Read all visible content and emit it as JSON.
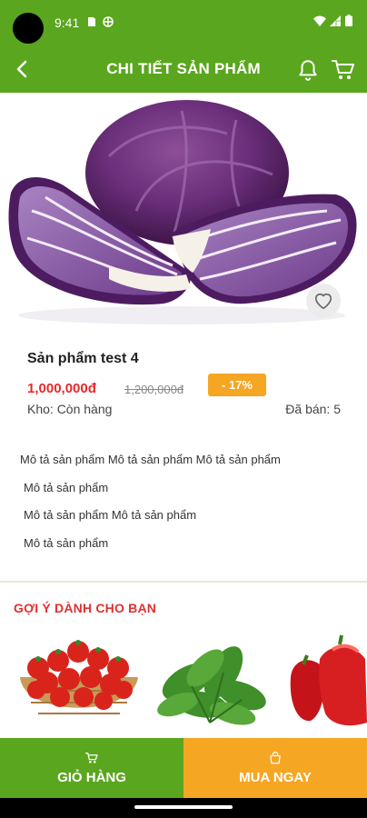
{
  "status": {
    "time": "9:41"
  },
  "header": {
    "title": "CHI TIẾT SẢN PHẨM"
  },
  "colors": {
    "brand_green": "#5aa61e",
    "accent_orange": "#f5a623",
    "price_red": "#e8282a"
  },
  "icons": [
    "back-arrow-icon",
    "bell-icon",
    "cart-icon",
    "heart-icon",
    "wifi-icon",
    "signal-icon",
    "battery-icon"
  ],
  "product": {
    "name": "Sản phẩm test 4",
    "price": "1,000,000đ",
    "old_price": "1,200,000đ",
    "discount": "- 17%",
    "stock": "Kho: Còn hàng",
    "sold": "Đã bán: 5",
    "description": [
      "Mô tả sản phẩm Mô tả sản phẩm Mô tả sản phẩm",
      "Mô tả sản phẩm",
      "Mô tả sản phẩm Mô tả sản phẩm",
      "Mô tả sản phẩm"
    ]
  },
  "suggestions": {
    "title": "GỢI Ý DÀNH CHO BẠN",
    "items": [
      "tomatoes",
      "spinach",
      "red-bell-peppers"
    ]
  },
  "actions": {
    "add_to_cart": "GIỎ HÀNG",
    "buy_now": "MUA NGAY"
  }
}
